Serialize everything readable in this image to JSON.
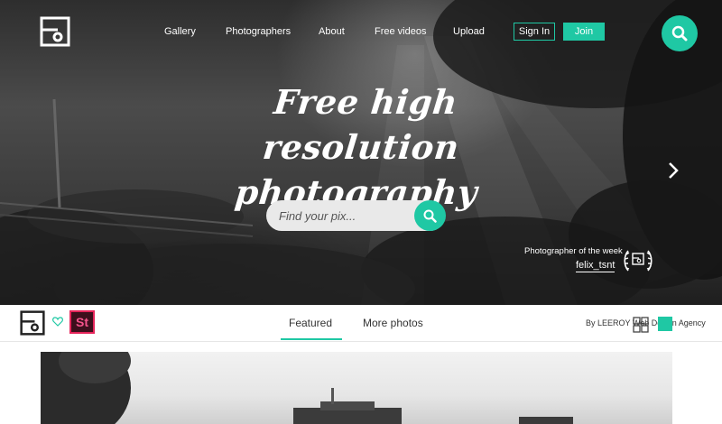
{
  "nav": {
    "items": [
      {
        "label": "Gallery"
      },
      {
        "label": "Photographers"
      },
      {
        "label": "About"
      },
      {
        "label": "Free videos"
      },
      {
        "label": "Upload"
      }
    ],
    "sign_in": "Sign In",
    "join": "Join"
  },
  "hero": {
    "headline_line1": "Free high resolution",
    "headline_line2": "photography",
    "search_placeholder": "Find your pix..."
  },
  "photographer_of_week": {
    "label": "Photographer of the week",
    "name": "felix_tsnt"
  },
  "subbar": {
    "tab_featured": "Featured",
    "tab_more": "More photos",
    "credit": "By LEEROY Web Design Agency",
    "badge": "St"
  },
  "colors": {
    "accent": "#1fc8a4",
    "adobe_stock_border": "#e6245a",
    "adobe_stock_bg": "#3d0f1c"
  },
  "icons": [
    "logo-icon",
    "search-icon",
    "chevron-right-icon",
    "heart-icon",
    "award-icon",
    "grid-icon"
  ]
}
